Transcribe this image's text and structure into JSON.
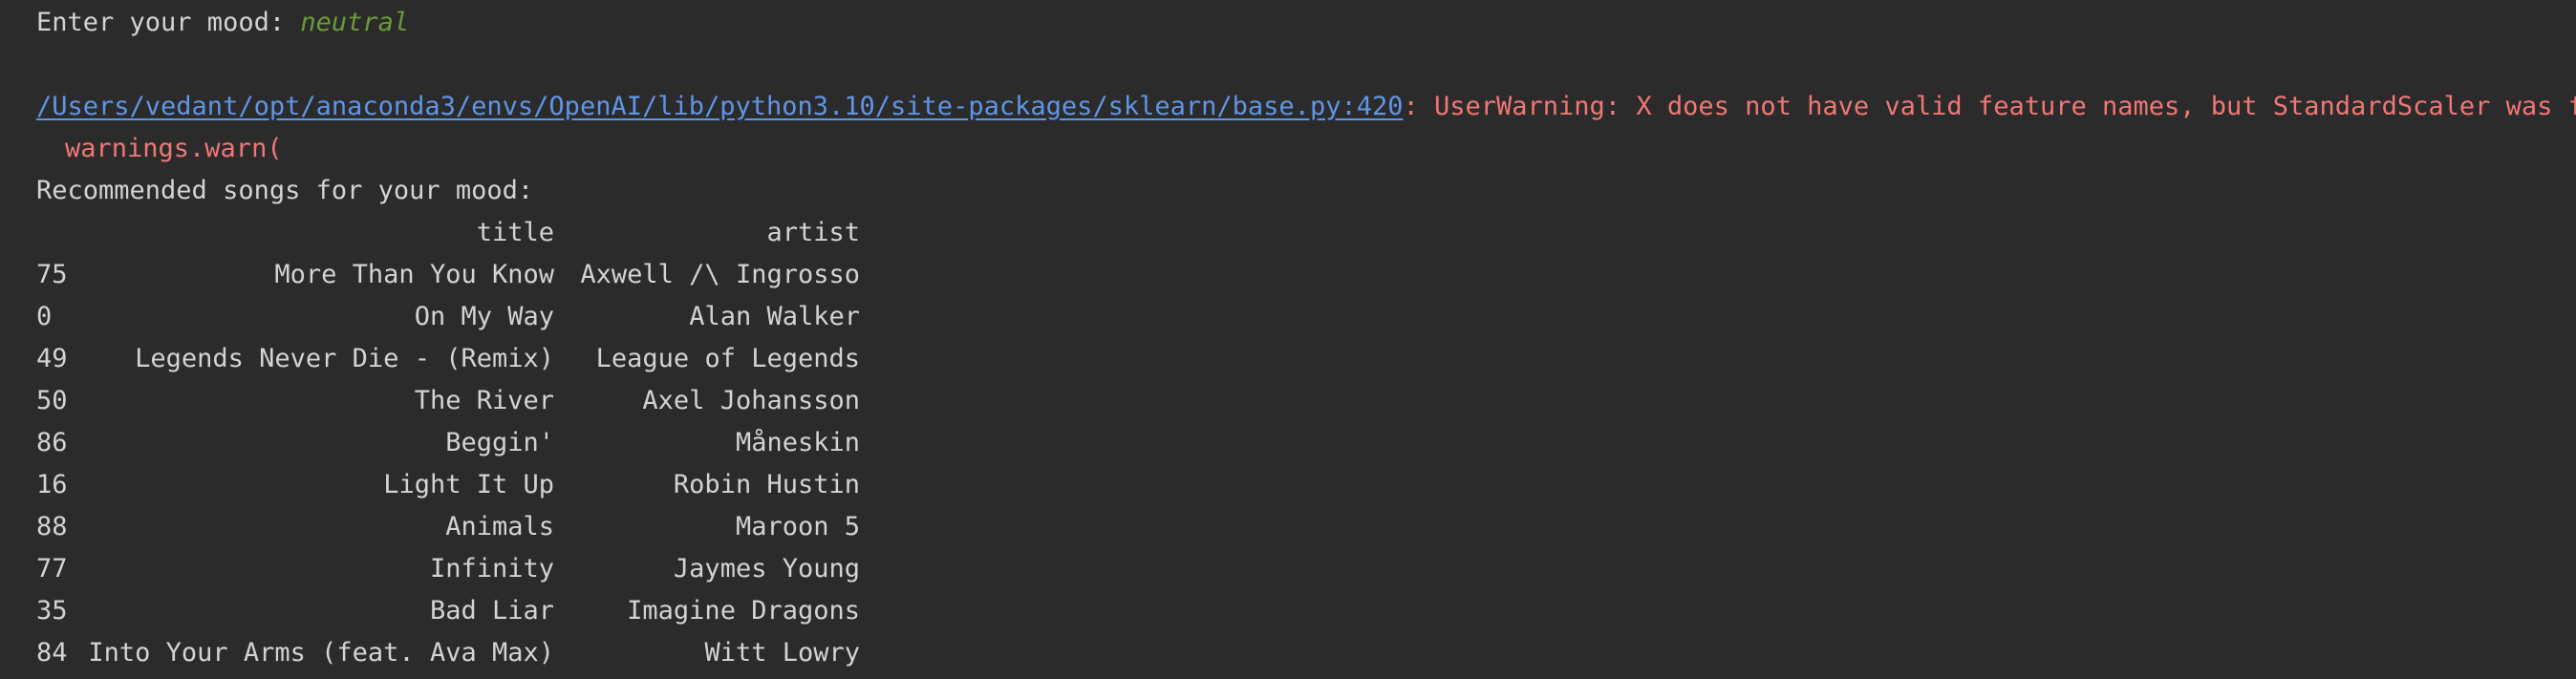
{
  "console": {
    "prompt_label": "Enter your mood: ",
    "mood_value": "neutral",
    "warning_path": "/Users/vedant/opt/anaconda3/envs/OpenAI/lib/python3.10/site-packages/sklearn/base.py:420",
    "warning_message": ": UserWarning: X does not have valid feature names, but StandardScaler was fitted with feature names",
    "warning_call": "warnings.warn(",
    "recommend_heading": "Recommended songs for your mood:"
  },
  "table": {
    "columns": [
      "title",
      "artist"
    ],
    "rows": [
      {
        "index": "75",
        "title": "More Than You Know",
        "artist": "Axwell /\\ Ingrosso"
      },
      {
        "index": "0",
        "title": "On My Way",
        "artist": "Alan Walker"
      },
      {
        "index": "49",
        "title": "Legends Never Die - (Remix)",
        "artist": "League of Legends"
      },
      {
        "index": "50",
        "title": "The River",
        "artist": "Axel Johansson"
      },
      {
        "index": "86",
        "title": "Beggin'",
        "artist": "Måneskin"
      },
      {
        "index": "16",
        "title": "Light It Up",
        "artist": "Robin Hustin"
      },
      {
        "index": "88",
        "title": "Animals",
        "artist": "Maroon 5"
      },
      {
        "index": "77",
        "title": "Infinity",
        "artist": "Jaymes Young"
      },
      {
        "index": "35",
        "title": "Bad Liar",
        "artist": "Imagine Dragons"
      },
      {
        "index": "84",
        "title": "Into Your Arms (feat. Ava Max)",
        "artist": "Witt Lowry"
      }
    ]
  },
  "colors": {
    "background": "#2b2b2b",
    "text": "#d1d3d6",
    "input": "#6a9a3a",
    "link": "#5f95e6",
    "warning": "#f07775"
  }
}
